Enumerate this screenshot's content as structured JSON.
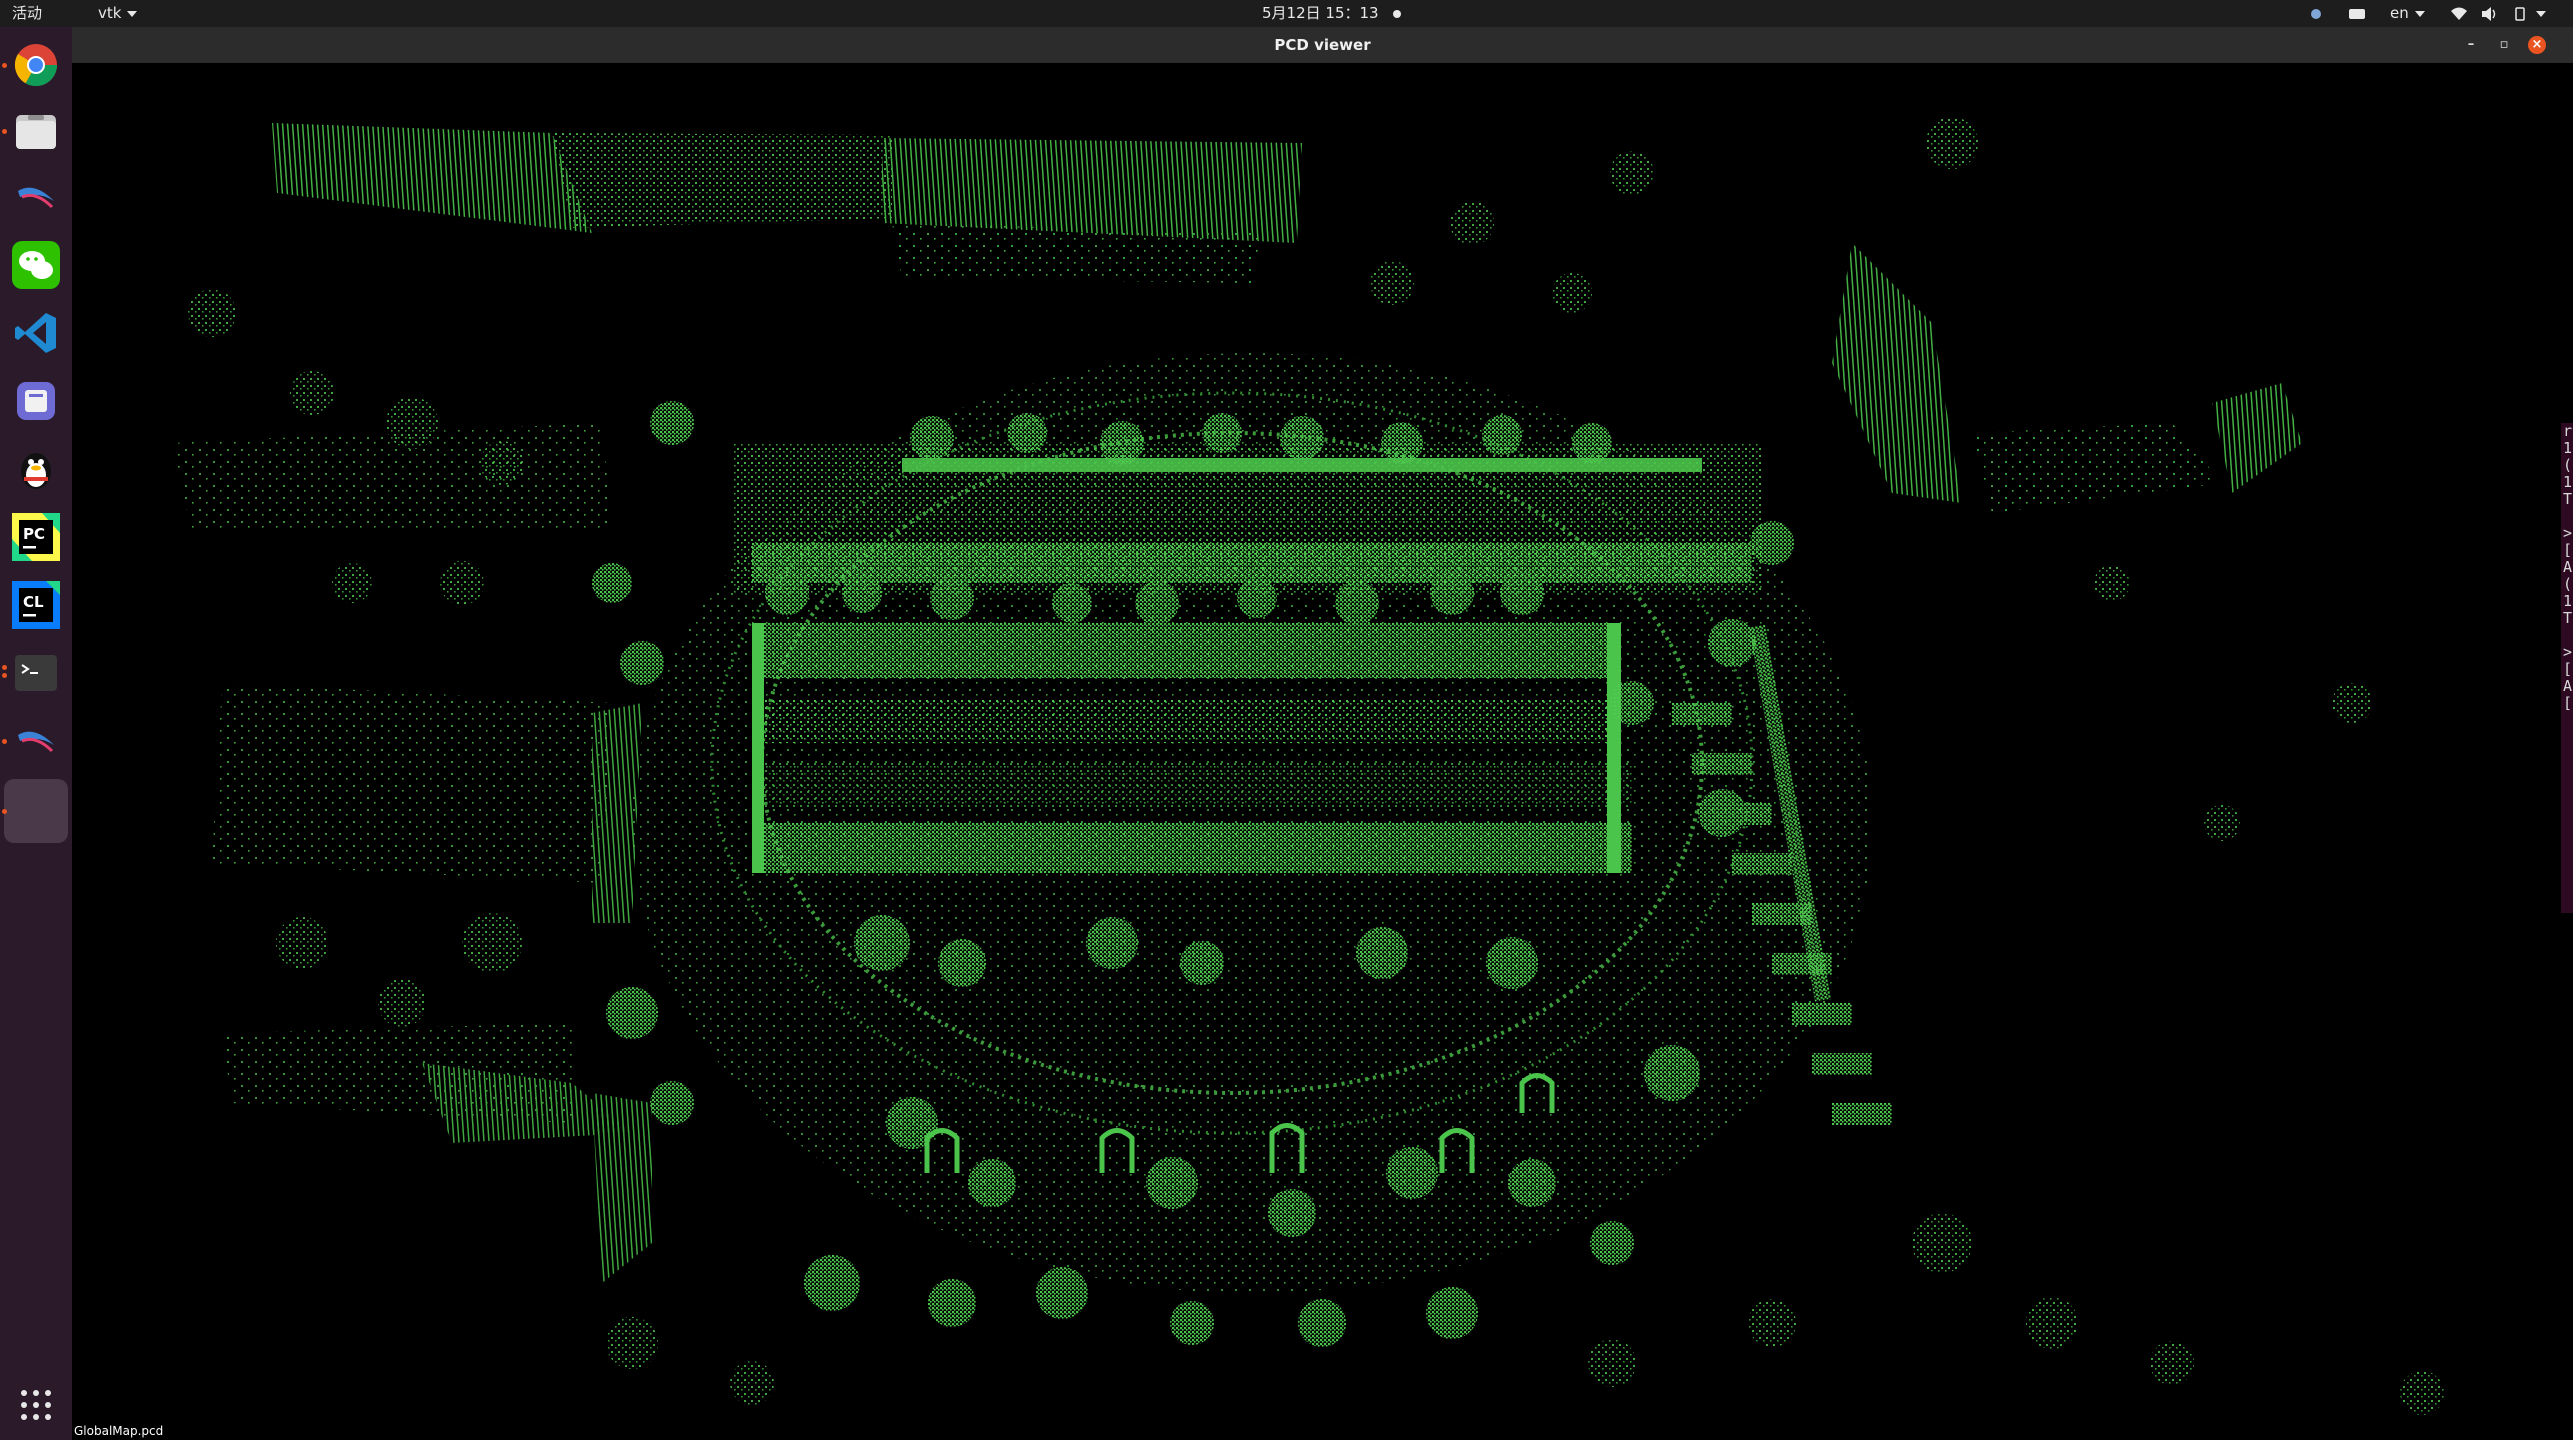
{
  "topbar": {
    "activities": "活动",
    "app_menu": "vtk",
    "clock": "5月12日  15：13",
    "language": "en"
  },
  "dock": {
    "apps": [
      {
        "name": "chrome-icon",
        "running": true
      },
      {
        "name": "files-icon",
        "running": true
      },
      {
        "name": "kali-dragon-icon",
        "running": false
      },
      {
        "name": "wechat-icon",
        "running": false
      },
      {
        "name": "vscode-icon",
        "running": false
      },
      {
        "name": "app-icon",
        "running": false
      },
      {
        "name": "qq-penguin-icon",
        "running": false
      },
      {
        "name": "pycharm-icon",
        "running": false
      },
      {
        "name": "clion-icon",
        "running": false
      },
      {
        "name": "terminal-icon",
        "running": true
      },
      {
        "name": "kali-dragon-icon-2",
        "running": false
      },
      {
        "name": "pcd-viewer-icon",
        "running": true
      }
    ],
    "show_apps": "show-applications-icon"
  },
  "window": {
    "title": "PCD viewer",
    "status_file": "GlobalMap.pcd",
    "point_color": "#4bc44b"
  },
  "terminal_sliver": {
    "lines": [
      "r",
      "1",
      "(",
      "1",
      "T",
      "",
      ">",
      "[",
      "A",
      "(",
      "1",
      "T",
      "",
      ">",
      "[",
      "A",
      "[",
      "",
      ""
    ]
  }
}
